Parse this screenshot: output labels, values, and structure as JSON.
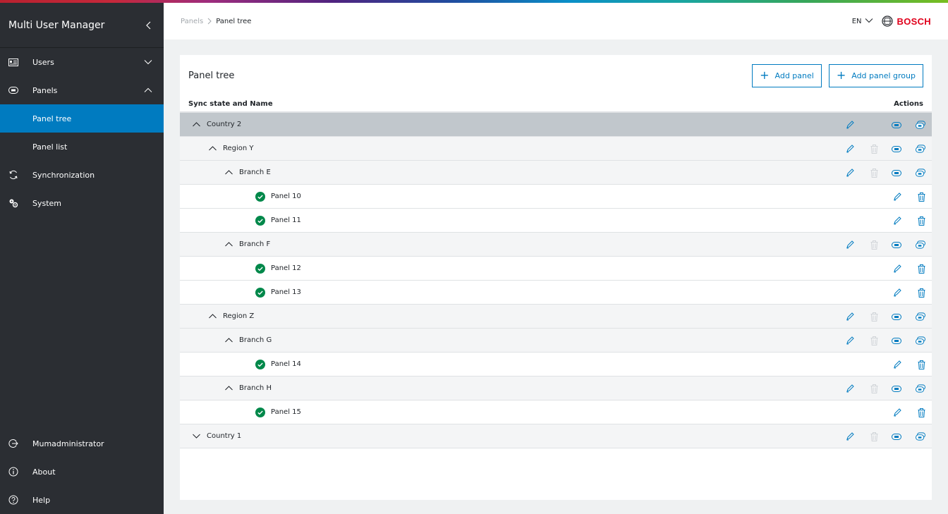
{
  "sidebar": {
    "title": "Multi User Manager",
    "items": [
      {
        "label": "Users",
        "icon": "users-card-icon",
        "chevron": "down"
      },
      {
        "label": "Panels",
        "icon": "panel-icon",
        "chevron": "up"
      }
    ],
    "subitems": [
      {
        "label": "Panel tree",
        "active": true
      },
      {
        "label": "Panel list",
        "active": false
      }
    ],
    "more_items": [
      {
        "label": "Synchronization",
        "icon": "sync-icon"
      },
      {
        "label": "System",
        "icon": "gears-icon"
      }
    ],
    "bottom_items": [
      {
        "label": "Mumadministrator",
        "icon": "logout-icon"
      },
      {
        "label": "About",
        "icon": "info-icon"
      },
      {
        "label": "Help",
        "icon": "help-icon"
      }
    ]
  },
  "header": {
    "breadcrumb_parent": "Panels",
    "breadcrumb_current": "Panel tree",
    "language": "EN",
    "brand": "BOSCH"
  },
  "card": {
    "title": "Panel tree",
    "add_panel_label": "Add panel",
    "add_group_label": "Add panel group",
    "col_name": "Sync state and Name",
    "col_actions": "Actions"
  },
  "colors": {
    "accent": "#007bc0",
    "sidebar_bg": "#2b2e33",
    "success": "#00884a",
    "brand_red": "#e0001b"
  },
  "tree": [
    {
      "label": "Country 2",
      "type": "group",
      "level": 0,
      "expanded": true,
      "selected": true
    },
    {
      "label": "Region Y",
      "type": "group",
      "level": 1,
      "expanded": true
    },
    {
      "label": "Branch E",
      "type": "group",
      "level": 2,
      "expanded": true
    },
    {
      "label": "Panel 10",
      "type": "panel",
      "level": 3,
      "synced": true
    },
    {
      "label": "Panel 11",
      "type": "panel",
      "level": 3,
      "synced": true
    },
    {
      "label": "Branch F",
      "type": "group",
      "level": 2,
      "expanded": true
    },
    {
      "label": "Panel 12",
      "type": "panel",
      "level": 3,
      "synced": true
    },
    {
      "label": "Panel 13",
      "type": "panel",
      "level": 3,
      "synced": true
    },
    {
      "label": "Region Z",
      "type": "group",
      "level": 1,
      "expanded": true
    },
    {
      "label": "Branch G",
      "type": "group",
      "level": 2,
      "expanded": true
    },
    {
      "label": "Panel 14",
      "type": "panel",
      "level": 3,
      "synced": true
    },
    {
      "label": "Branch H",
      "type": "group",
      "level": 2,
      "expanded": true
    },
    {
      "label": "Panel 15",
      "type": "panel",
      "level": 3,
      "synced": true
    },
    {
      "label": "Country 1",
      "type": "group",
      "level": 0,
      "expanded": false
    }
  ]
}
